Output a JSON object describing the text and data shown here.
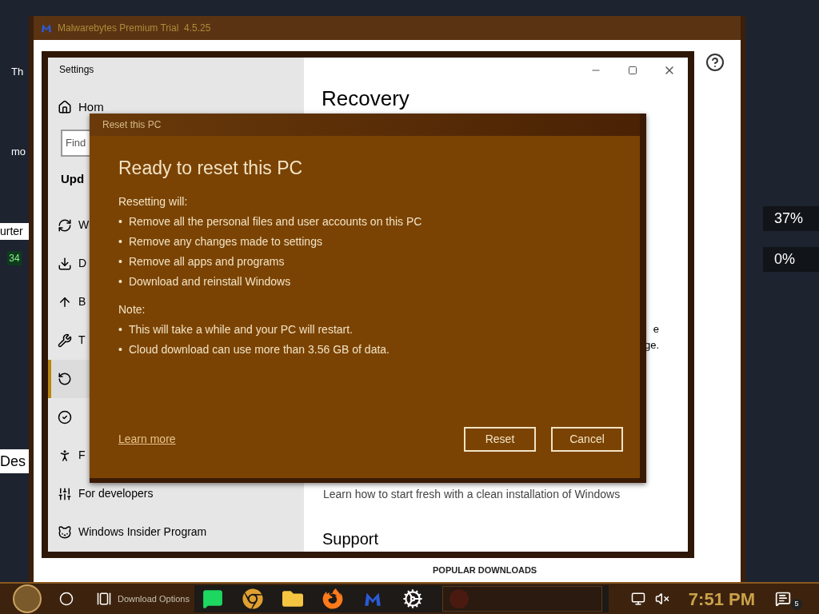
{
  "desktop": {
    "left_texts": [
      {
        "kind": "dark",
        "text": "Th"
      },
      {
        "kind": "dark",
        "text": "mo"
      },
      {
        "kind": "panel",
        "text": "urter"
      },
      {
        "kind": "badge",
        "text": "34"
      },
      {
        "kind": "heading",
        "text": "Des"
      }
    ],
    "gauges": [
      {
        "reading": "37%"
      },
      {
        "reading": "0%"
      }
    ]
  },
  "background_window": {
    "title": "Malwarebytes Premium Trial  4.5.25",
    "section_heading": "POPULAR DOWNLOADS"
  },
  "settings": {
    "title": "Settings",
    "home": "Hom",
    "search": {
      "placeholder": "Find"
    },
    "section": "Upd",
    "nav": [
      {
        "label": "W",
        "selected": false
      },
      {
        "label": "D",
        "selected": false
      },
      {
        "label": "B",
        "selected": false
      },
      {
        "label": "T",
        "selected": false
      },
      {
        "selected": true
      },
      {
        "selected": false
      },
      {
        "label": "F",
        "selected": false
      },
      {
        "label": "For developers",
        "selected": false
      },
      {
        "label": "Windows Insider Program",
        "selected": false
      }
    ],
    "page_title": "Recovery",
    "fragments": [
      "e",
      "ge."
    ],
    "link": "Learn how to start fresh with a clean installation of Windows",
    "subheading": "Support"
  },
  "dialog": {
    "title": "Reset this PC",
    "heading": "Ready to reset this PC",
    "groups": [
      {
        "label": "Resetting will:",
        "items": [
          {
            "bullet": "•",
            "text": "Remove all the personal files and user accounts on this PC"
          },
          {
            "bullet": "•",
            "text": "Remove any changes made to settings"
          },
          {
            "bullet": "•",
            "text": "Remove all apps and programs"
          },
          {
            "bullet": "•",
            "text": "Download and reinstall Windows"
          }
        ]
      },
      {
        "label": "Note:",
        "items": [
          {
            "bullet": "•",
            "text": "This will take a while and your PC will restart."
          },
          {
            "bullet": "•",
            "text": "Cloud download can use more than 3.56 GB of data."
          }
        ]
      }
    ],
    "link": "Learn more",
    "buttons": [
      "Reset",
      "Cancel"
    ]
  },
  "taskbar": {
    "behind_text": "Download Options",
    "apps": [
      {
        "kind": "chat"
      },
      {
        "kind": "chrome"
      },
      {
        "kind": "folder"
      },
      {
        "kind": "firefox"
      },
      {
        "kind": "malwarebytes"
      },
      {
        "kind": "settings"
      },
      {
        "kind": "dim"
      }
    ],
    "clock": "7:51 PM",
    "notifications": "5"
  }
}
